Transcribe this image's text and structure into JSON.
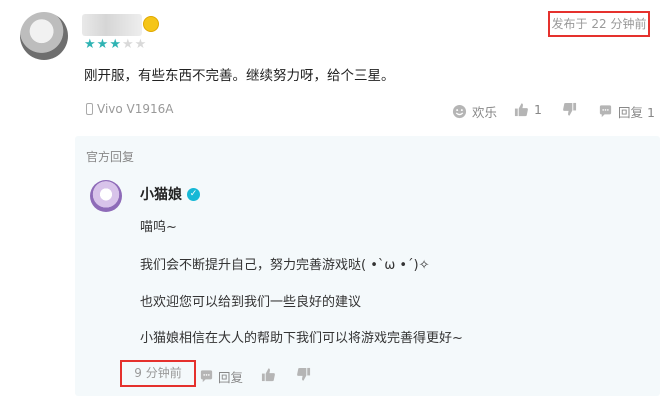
{
  "comment": {
    "rating": 3,
    "rating_max": 5,
    "time": "发布于 22 分钟前",
    "text": "刚开服，有些东西不完善。继续努力呀，给个三星。",
    "device": "Vivo V1916A",
    "actions": {
      "funny_label": "欢乐",
      "like_count": "1",
      "reply_label": "回复 1"
    }
  },
  "official_reply": {
    "section_label": "官方回复",
    "author": "小猫娘",
    "lines": [
      "喵呜~",
      "我们会不断提升自己，努力完善游戏哒( •`ω •´)✧",
      "也欢迎您可以给到我们一些良好的建议",
      "小猫娘相信在大人的帮助下我们可以将游戏完善得更好~"
    ],
    "time": "9 分钟前",
    "reply_label": "回复"
  },
  "colors": {
    "highlight_border": "#e5312d",
    "star_active": "#2fb3b3",
    "verified": "#17b8d6",
    "official_bg": "#f4f9fb"
  }
}
